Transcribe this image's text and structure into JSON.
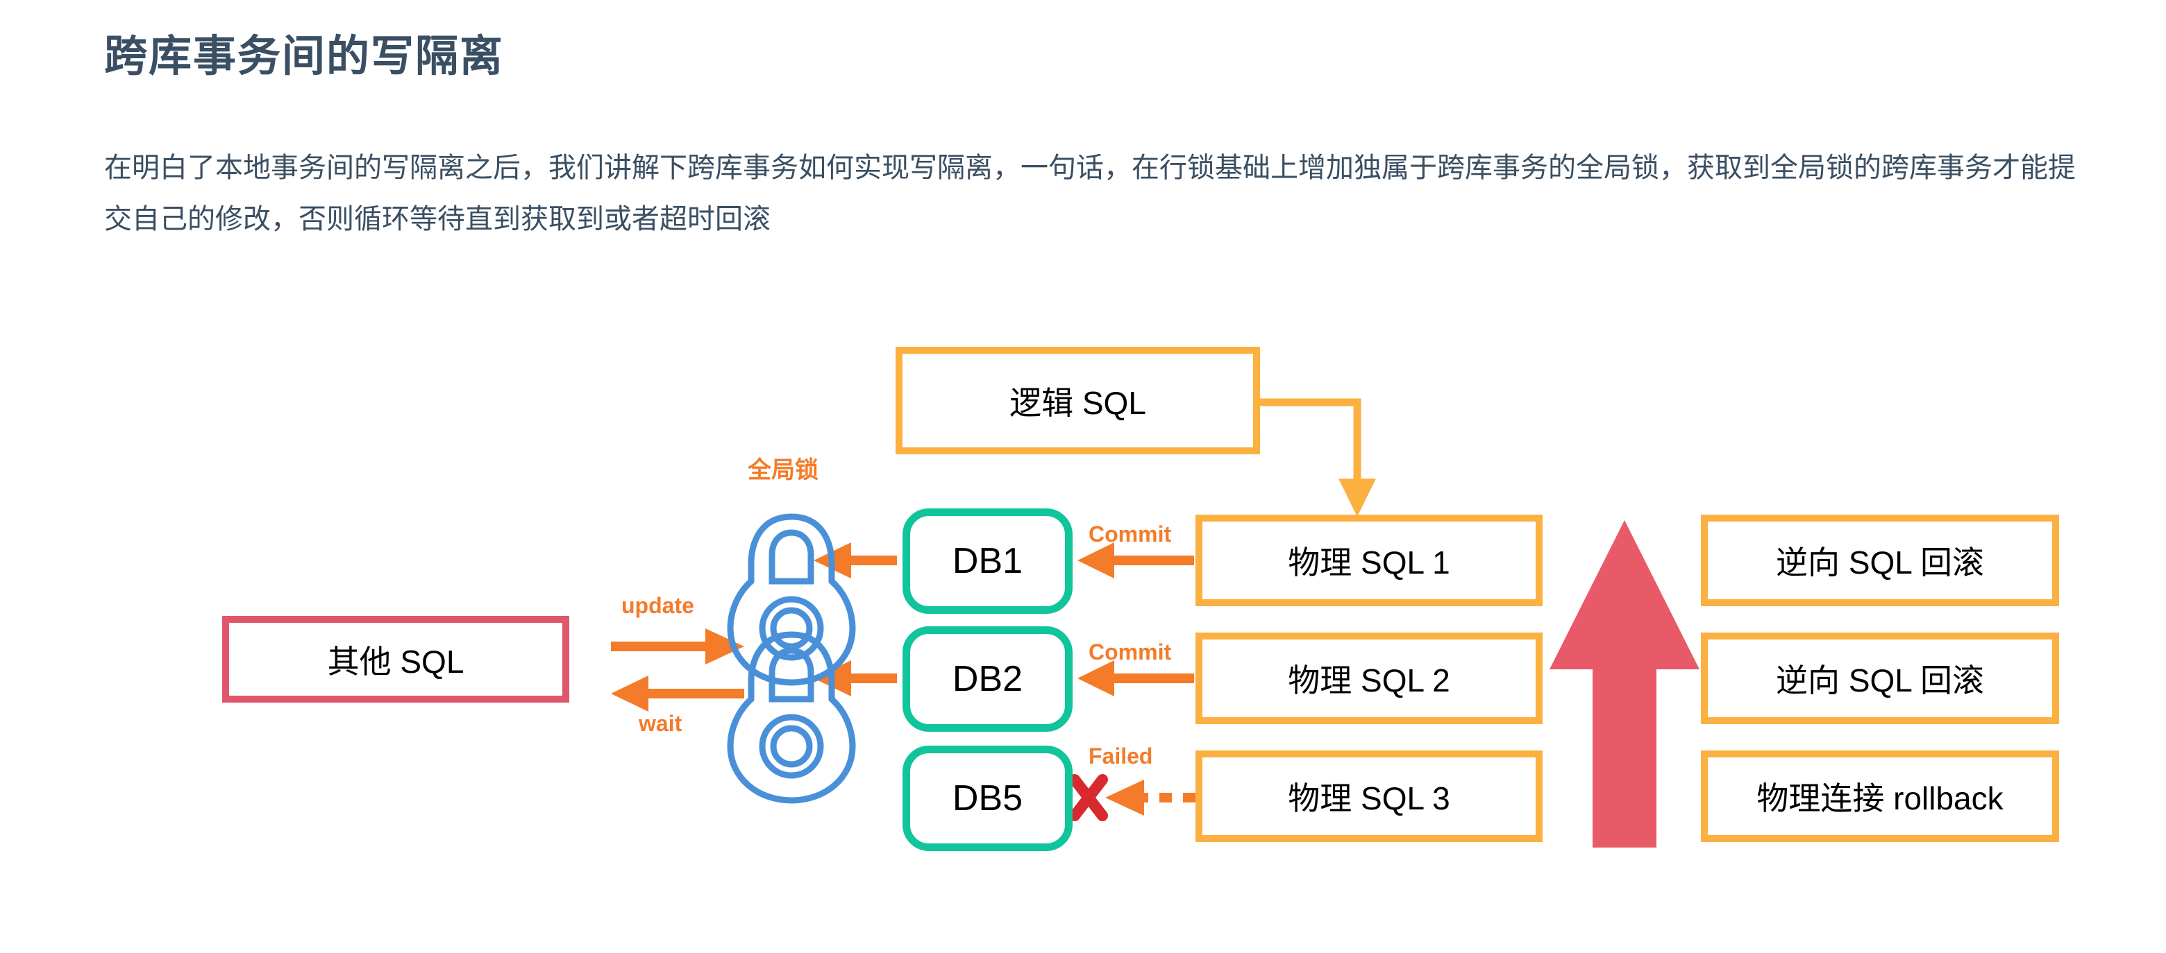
{
  "page": {
    "title": "跨库事务间的写隔离",
    "paragraph": "在明白了本地事务间的写隔离之后，我们讲解下跨库事务如何实现写隔离，一句话，在行锁基础上增加独属于跨库事务的全局锁，获取到全局锁的跨库事务才能提交自己的修改，否则循环等待直到获取到或者超时回滚"
  },
  "colors": {
    "title": "#3A4F63",
    "orange_border": "#FBB040",
    "orange_accent": "#F47B29",
    "red_border": "#E0566B",
    "red_arrow": "#E85A68",
    "teal_border": "#10C49B",
    "lock_blue": "#4A90D9",
    "cross_red": "#D8292F",
    "text": "#000000"
  },
  "diagram": {
    "logical_sql": {
      "label": "逻辑 SQL"
    },
    "other_sql": {
      "label": "其他 SQL"
    },
    "global_lock_label": "全局锁",
    "flow_labels": {
      "update": "update",
      "wait": "wait"
    },
    "databases": [
      {
        "name": "DB1",
        "status_label": "Commit",
        "status": "commit"
      },
      {
        "name": "DB2",
        "status_label": "Commit",
        "status": "commit"
      },
      {
        "name": "DB5",
        "status_label": "Failed",
        "status": "failed"
      }
    ],
    "physical_sql": [
      {
        "label": "物理 SQL 1"
      },
      {
        "label": "物理 SQL 2"
      },
      {
        "label": "物理 SQL 3"
      }
    ],
    "rollback": [
      {
        "label": "逆向 SQL 回滚"
      },
      {
        "label": "逆向 SQL 回滚"
      },
      {
        "label": "物理连接 rollback"
      }
    ],
    "icons": {
      "lock": "padlock-icon",
      "failure": "cross-mark-icon",
      "rollback_direction": "up-arrow-icon"
    }
  }
}
